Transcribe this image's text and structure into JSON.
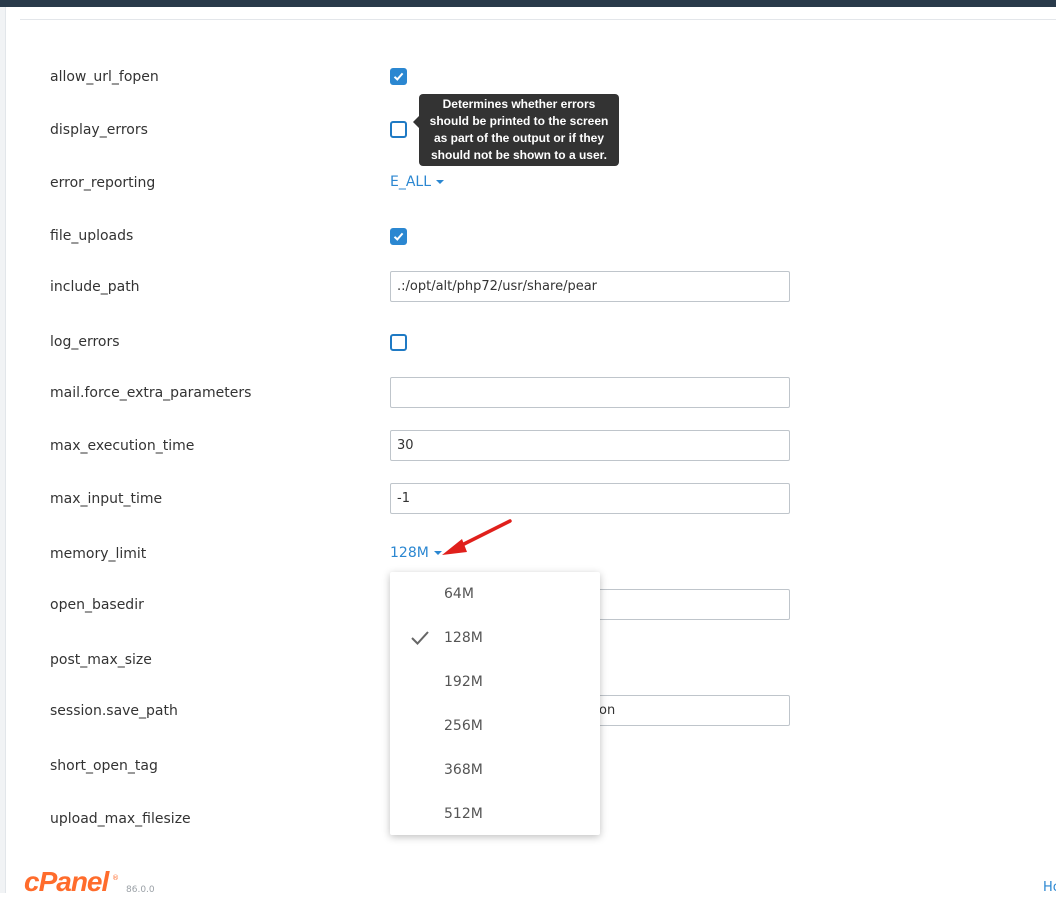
{
  "colors": {
    "accent": "#2b87d1",
    "topbar": "#293a4a",
    "brand": "#ff6c2c",
    "tooltip_bg": "#333333",
    "annotation": "#e0201c"
  },
  "settings": {
    "allow_url_fopen": {
      "label": "allow_url_fopen",
      "checked": true
    },
    "display_errors": {
      "label": "display_errors",
      "checked": false
    },
    "error_reporting": {
      "label": "error_reporting",
      "value": "E_ALL"
    },
    "file_uploads": {
      "label": "file_uploads",
      "checked": true
    },
    "include_path": {
      "label": "include_path",
      "value": ".:/opt/alt/php72/usr/share/pear"
    },
    "log_errors": {
      "label": "log_errors",
      "checked": false
    },
    "mail_force_extra_parameters": {
      "label": "mail.force_extra_parameters",
      "value": ""
    },
    "max_execution_time": {
      "label": "max_execution_time",
      "value": "30"
    },
    "max_input_time": {
      "label": "max_input_time",
      "value": "-1"
    },
    "memory_limit": {
      "label": "memory_limit",
      "value": "128M"
    },
    "open_basedir": {
      "label": "open_basedir",
      "value": ""
    },
    "post_max_size": {
      "label": "post_max_size"
    },
    "session_save_path": {
      "label": "session.save_path",
      "value_visible_fragment": "on"
    },
    "short_open_tag": {
      "label": "short_open_tag"
    },
    "upload_max_filesize": {
      "label": "upload_max_filesize"
    }
  },
  "tooltip": {
    "text": "Determines whether errors should be printed to the screen as part of the output or if they should not be shown to a user."
  },
  "memory_menu": {
    "options": [
      "64M",
      "128M",
      "192M",
      "256M",
      "368M",
      "512M"
    ],
    "selected": "128M"
  },
  "annotation": {
    "icon": "red-arrow-icon"
  },
  "footer": {
    "brand": "cPanel",
    "reg": "®",
    "version": "86.0.0",
    "help_link": "Ho"
  }
}
